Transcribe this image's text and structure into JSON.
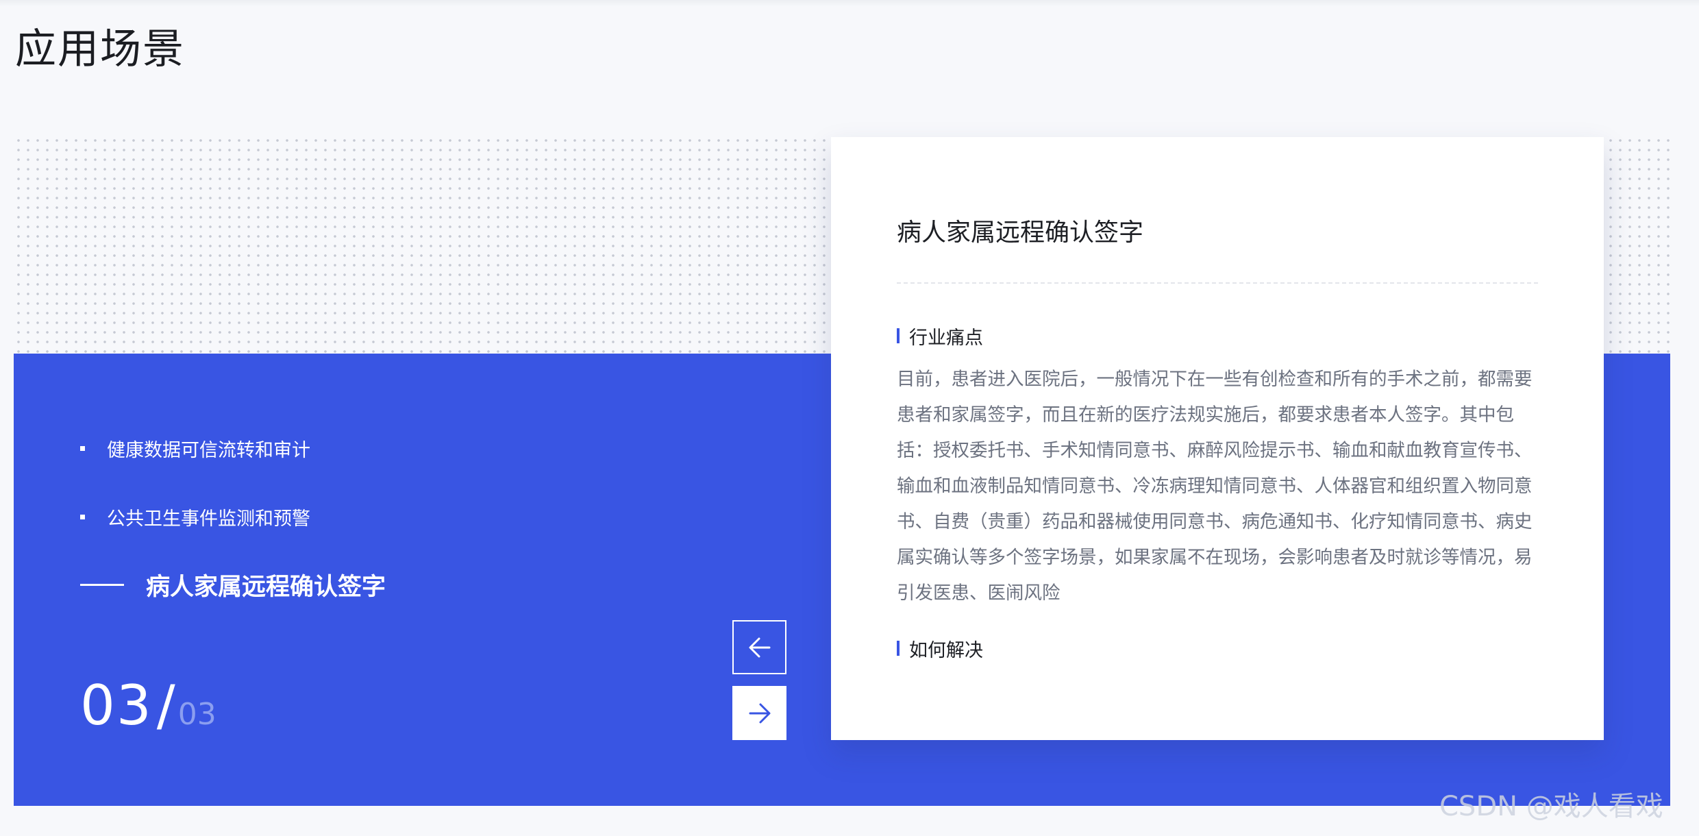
{
  "page": {
    "title": "应用场景"
  },
  "carousel": {
    "items": [
      {
        "label": "健康数据可信流转和审计"
      },
      {
        "label": "公共卫生事件监测和预警"
      }
    ],
    "active_label": "病人家属远程确认签字",
    "counter": {
      "current": "03",
      "separator": "/",
      "total": "03"
    },
    "prev_icon": "arrow-left-icon",
    "next_icon": "arrow-right-icon"
  },
  "card": {
    "title": "病人家属远程确认签字",
    "sections": [
      {
        "heading": "行业痛点",
        "text": "目前，患者进入医院后，一般情况下在一些有创检查和所有的手术之前，都需要患者和家属签字，而且在新的医疗法规实施后，都要求患者本人签字。其中包括：授权委托书、手术知情同意书、麻醉风险提示书、输血和献血教育宣传书、输血和血液制品知情同意书、冷冻病理知情同意书、人体器官和组织置入物同意书、自费（贵重）药品和器械使用同意书、病危通知书、化疗知情同意书、病史属实确认等多个签字场景，如果家属不在现场，会影响患者及时就诊等情况，易引发医患、医闹风险"
      },
      {
        "heading": "如何解决",
        "text": ""
      }
    ]
  },
  "watermark": "CSDN @戏人看戏",
  "colors": {
    "accent": "#3955e3",
    "background": "#f7f8fb",
    "card": "#ffffff",
    "body_text": "#6c7280",
    "title_text": "#1d1f24"
  }
}
